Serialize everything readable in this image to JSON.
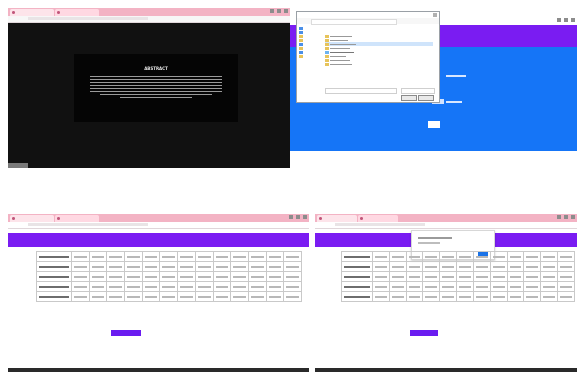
{
  "panels": [
    {
      "id": "top-left",
      "tabs": [
        "",
        ""
      ],
      "modal": {
        "title": "ABSTRACT",
        "lines": [
          "",
          "",
          "",
          "",
          "",
          "",
          "",
          ""
        ]
      }
    },
    {
      "id": "top-right",
      "dialog": {
        "title": "Open",
        "sidebar": [
          "",
          "",
          "",
          "",
          "",
          "",
          "",
          ""
        ],
        "files": [
          "",
          "",
          "",
          "",
          "",
          "",
          "",
          "",
          ""
        ],
        "filename_label": "",
        "open_label": "",
        "cancel_label": ""
      },
      "hero": {
        "title": "",
        "upload_label": "",
        "button": ""
      }
    },
    {
      "id": "bottom-left",
      "header_title": "",
      "button_label": "",
      "rows": 5
    },
    {
      "id": "bottom-right",
      "header_title": "",
      "popup": {
        "text": "",
        "ok": ""
      },
      "button_label": "",
      "rows": 5
    }
  ],
  "colors": {
    "violet": "#7a1cf2",
    "blue": "#1575f7",
    "dark": "#111111",
    "tab_pink": "#f3b3c4"
  }
}
